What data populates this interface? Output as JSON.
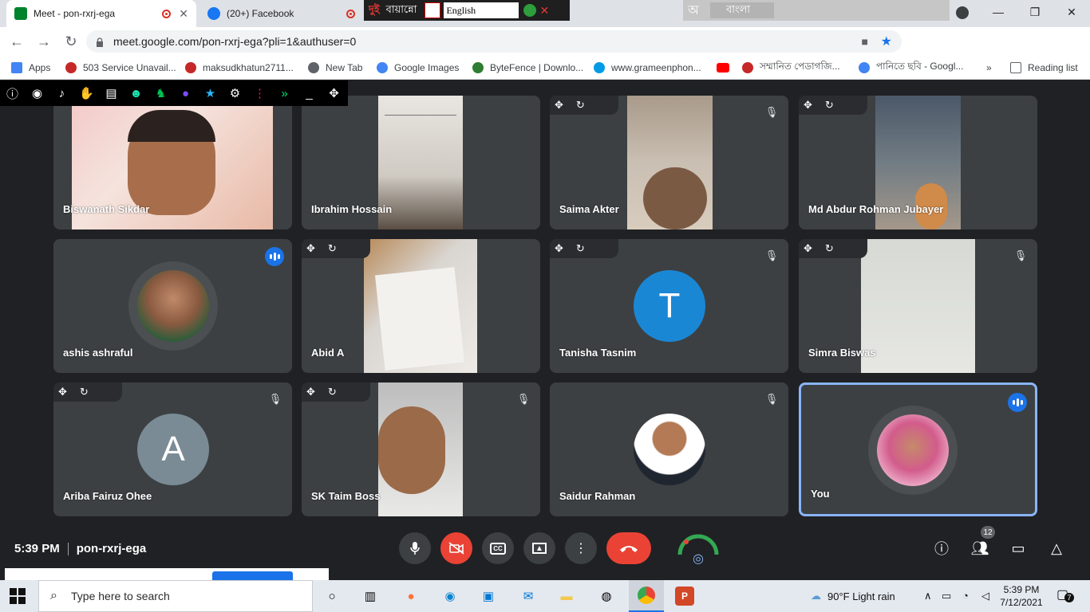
{
  "browser": {
    "tabs": [
      {
        "title": "Meet - pon-rxrj-ega",
        "active": true
      },
      {
        "title": "(20+) Facebook",
        "active": false
      }
    ],
    "overlay": {
      "title": "বায়ান্নো",
      "lang": "English",
      "lang2": "বাংলা"
    },
    "url": "meet.google.com/pon-rxrj-ega?pli=1&authuser=0",
    "bookmarks": [
      {
        "label": "Apps"
      },
      {
        "label": "503 Service Unavail..."
      },
      {
        "label": "maksudkhatun2711..."
      },
      {
        "label": "New Tab"
      },
      {
        "label": "Google Images"
      },
      {
        "label": "ByteFence | Downlo..."
      },
      {
        "label": "www.grameenphon..."
      },
      {
        "label": ""
      },
      {
        "label": "সম্মানিত পেডাগজি..."
      },
      {
        "label": "পানিতে ছবি - Googl..."
      }
    ],
    "more": "»",
    "reading_list": "Reading list"
  },
  "participants": [
    {
      "name": "Biswanath Sikdar"
    },
    {
      "name": "Ibrahim Hossain"
    },
    {
      "name": "Saima Akter"
    },
    {
      "name": "Md Abdur Rohman Jubayer"
    },
    {
      "name": "ashis ashraful"
    },
    {
      "name": "Abid A"
    },
    {
      "name": "Tanisha Tasnim",
      "initial": "T"
    },
    {
      "name": "Simra Biswas"
    },
    {
      "name": "Ariba Fairuz Ohee",
      "initial": "A"
    },
    {
      "name": "SK Taim Boss"
    },
    {
      "name": "Saidur Rahman"
    },
    {
      "name": "You"
    }
  ],
  "meeting": {
    "time": "5:39 PM",
    "code": "pon-rxrj-ega",
    "participant_count": "12"
  },
  "taskbar": {
    "search_placeholder": "Type here to search",
    "weather": "90°F  Light rain",
    "time": "5:39 PM",
    "date": "7/12/2021",
    "notif_count": "7"
  }
}
